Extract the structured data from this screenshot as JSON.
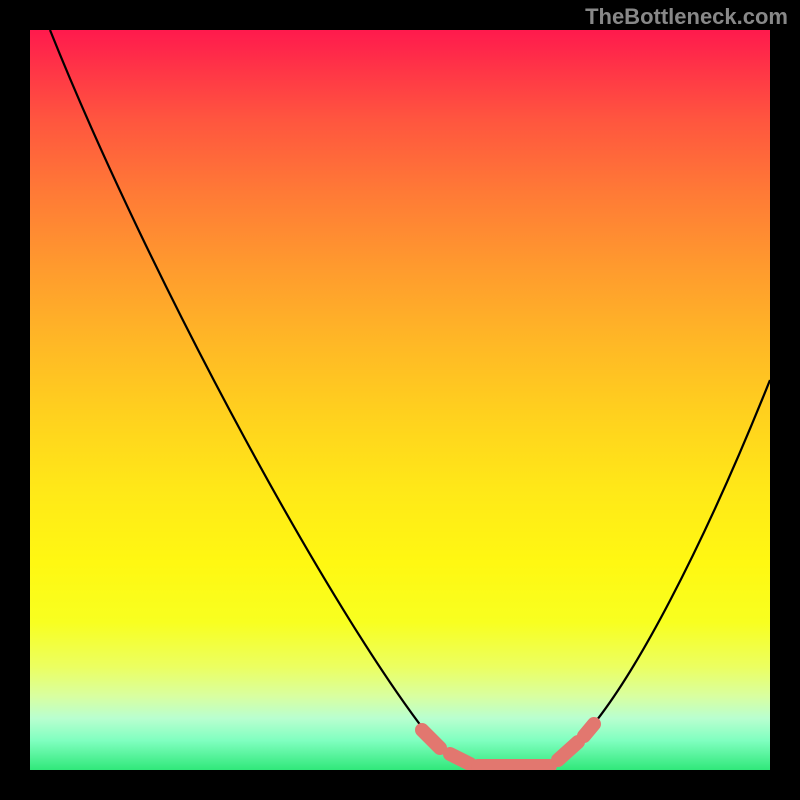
{
  "watermark": "TheBottleneck.com",
  "chart_data": {
    "type": "line",
    "title": "",
    "xlabel": "",
    "ylabel": "",
    "xlim": [
      0,
      100
    ],
    "ylim": [
      0,
      100
    ],
    "note": "Axes are unlabeled in the image; x and y expressed as percent of plot width/height. Higher y = worse (red), y≈0 = optimal (green). Curve shows a bottleneck V-shape with a flat optimal region roughly between x=58 and x=72.",
    "series": [
      {
        "name": "bottleneck-curve",
        "x": [
          3,
          10,
          20,
          30,
          40,
          50,
          55,
          58,
          62,
          66,
          70,
          73,
          76,
          80,
          85,
          90,
          95,
          100
        ],
        "y": [
          100,
          88,
          72,
          56,
          40,
          22,
          10,
          3,
          0,
          0,
          0,
          3,
          8,
          16,
          28,
          40,
          50,
          53
        ]
      }
    ],
    "highlight_region": {
      "x_start": 53,
      "x_end": 76,
      "description": "salmon dashed segments marking near-zero bottleneck zone"
    },
    "background_gradient": {
      "top_color": "#ff1a4d",
      "mid_color": "#ffe818",
      "bottom_color": "#30e87a",
      "meaning": "red=high bottleneck, green=no bottleneck"
    }
  }
}
